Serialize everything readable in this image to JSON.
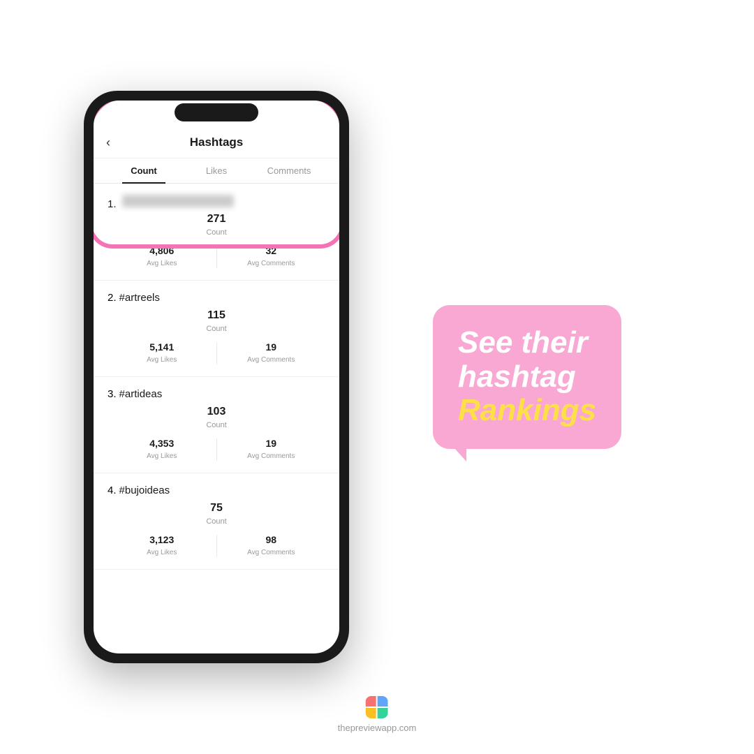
{
  "page": {
    "background": "#ffffff"
  },
  "phone": {
    "header": {
      "back_label": "‹",
      "title": "Hashtags"
    },
    "tabs": [
      {
        "label": "Count",
        "active": true
      },
      {
        "label": "Likes",
        "active": false
      },
      {
        "label": "Comments",
        "active": false
      }
    ],
    "hashtags": [
      {
        "rank": "1.",
        "name": "blurred",
        "count": "271",
        "count_label": "Count",
        "avg_likes": "4,806",
        "avg_likes_label": "Avg Likes",
        "avg_comments": "32",
        "avg_comments_label": "Avg Comments"
      },
      {
        "rank": "2.",
        "name": "#artreels",
        "count": "115",
        "count_label": "Count",
        "avg_likes": "5,141",
        "avg_likes_label": "Avg Likes",
        "avg_comments": "19",
        "avg_comments_label": "Avg Comments"
      },
      {
        "rank": "3.",
        "name": "#artideas",
        "count": "103",
        "count_label": "Count",
        "avg_likes": "4,353",
        "avg_likes_label": "Avg Likes",
        "avg_comments": "19",
        "avg_comments_label": "Avg Comments"
      },
      {
        "rank": "4.",
        "name": "#bujoideas",
        "count": "75",
        "count_label": "Count",
        "avg_likes": "3,123",
        "avg_likes_label": "Avg Likes",
        "avg_comments": "98",
        "avg_comments_label": "Avg Comments"
      }
    ]
  },
  "promo": {
    "line1": "See their",
    "line2": "hashtag",
    "line3": "Rankings"
  },
  "footer": {
    "url": "thepreviewapp.com"
  }
}
